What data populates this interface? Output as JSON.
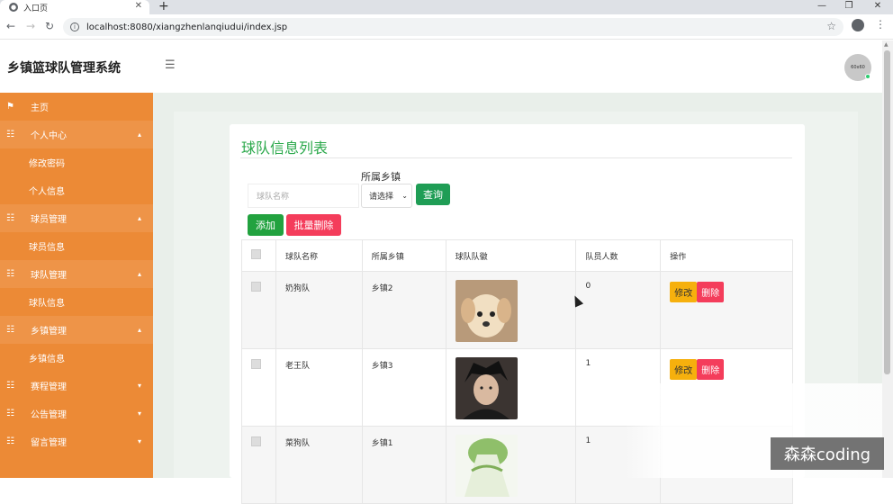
{
  "browser": {
    "tab_title": "入口页",
    "url": "localhost:8080/xiangzhenlanqiudui/index.jsp",
    "new_tab_symbol": "+",
    "close_symbol": "✕"
  },
  "header": {
    "app_title": "乡镇篮球队管理系统",
    "avatar_text": "60x60"
  },
  "sidebar": {
    "items": [
      {
        "label": "主页",
        "icon": "flag-icon",
        "type": "item"
      },
      {
        "label": "个人中心",
        "icon": "list-icon",
        "type": "group",
        "expanded": true
      },
      {
        "label": "修改密码",
        "type": "sub"
      },
      {
        "label": "个人信息",
        "type": "sub"
      },
      {
        "label": "球员管理",
        "icon": "list-icon",
        "type": "group",
        "expanded": true
      },
      {
        "label": "球员信息",
        "type": "sub"
      },
      {
        "label": "球队管理",
        "icon": "list-icon",
        "type": "group",
        "expanded": true
      },
      {
        "label": "球队信息",
        "type": "sub"
      },
      {
        "label": "乡镇管理",
        "icon": "list-icon",
        "type": "group",
        "expanded": true
      },
      {
        "label": "乡镇信息",
        "type": "sub"
      },
      {
        "label": "赛程管理",
        "icon": "list-icon",
        "type": "group",
        "expanded": false
      },
      {
        "label": "公告管理",
        "icon": "list-icon",
        "type": "group",
        "expanded": false
      },
      {
        "label": "留言管理",
        "icon": "list-icon",
        "type": "group",
        "expanded": false
      }
    ]
  },
  "main": {
    "title": "球队信息列表",
    "search_placeholder": "球队名称",
    "town_label": "所属乡镇",
    "town_select_value": "请选择",
    "query_label": "查询",
    "add_label": "添加",
    "batch_delete_label": "批量删除",
    "table": {
      "headers": [
        "球队名称",
        "所属乡镇",
        "球队队徽",
        "队员人数",
        "操作"
      ],
      "rows": [
        {
          "name": "奶狗队",
          "town": "乡镇2",
          "emblem": "puppy-image",
          "members": "0"
        },
        {
          "name": "老王队",
          "town": "乡镇3",
          "emblem": "man-portrait-image",
          "members": "1"
        },
        {
          "name": "菜狗队",
          "town": "乡镇1",
          "emblem": "cabbage-image",
          "members": "1"
        }
      ],
      "edit_label": "修改",
      "delete_label": "删除"
    }
  },
  "watermark": "森森coding",
  "colors": {
    "sidebar": "#ec8a36",
    "accent_green": "#2aa84a",
    "danger": "#f43d5b",
    "warning": "#f6b00d"
  }
}
